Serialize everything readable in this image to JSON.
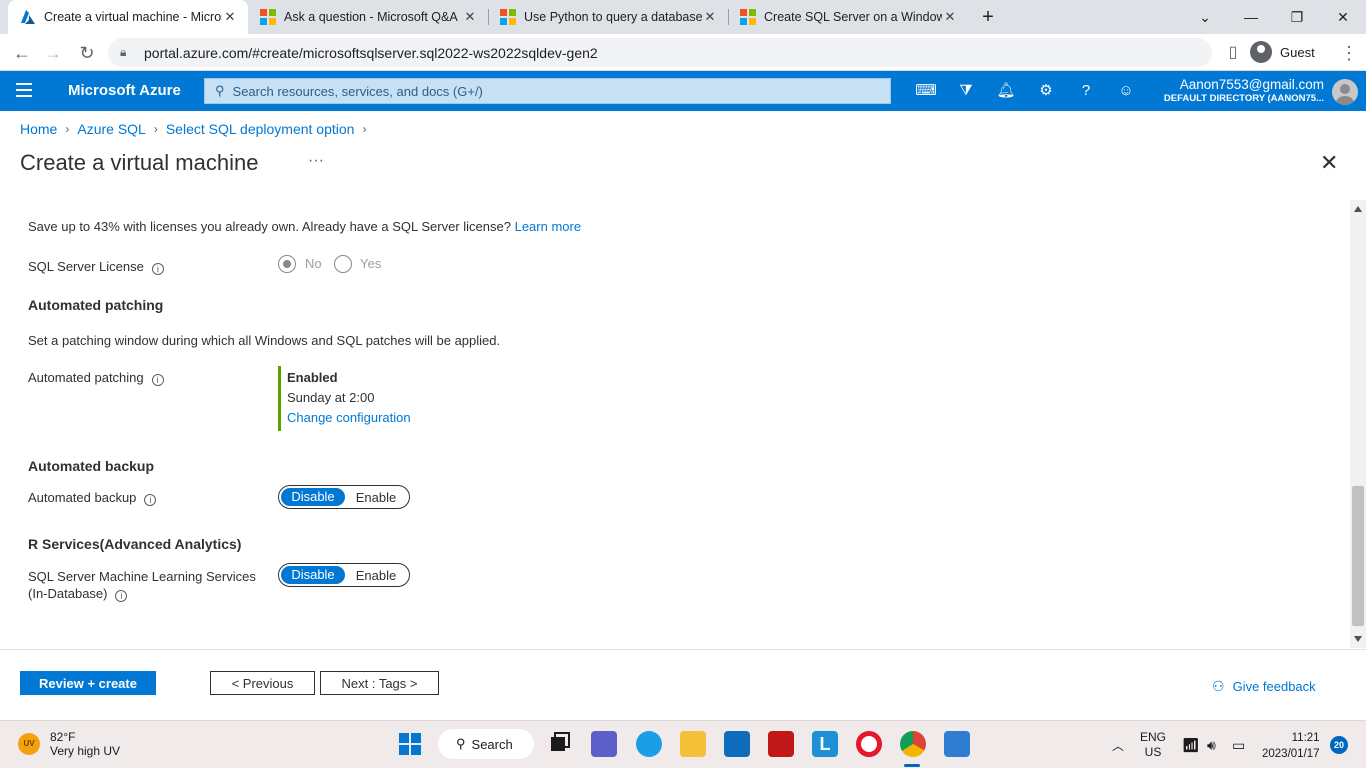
{
  "browser": {
    "tabs": [
      {
        "title": "Create a virtual machine - Micros",
        "icon": "azure-logo-icon",
        "active": true
      },
      {
        "title": "Ask a question - Microsoft Q&A",
        "icon": "microsoft-logo-icon"
      },
      {
        "title": "Use Python to query a database",
        "icon": "microsoft-logo-icon"
      },
      {
        "title": "Create SQL Server on a Windows",
        "icon": "microsoft-logo-icon"
      }
    ],
    "url": "portal.azure.com/#create/microsoftsqlserver.sql2022-ws2022sqldev-gen2",
    "profile": "Guest"
  },
  "azure_header": {
    "brand": "Microsoft Azure",
    "search_placeholder": "Search resources, services, and docs (G+/)",
    "account_email": "Aanon7553@gmail.com",
    "account_directory": "DEFAULT DIRECTORY (AANON75..."
  },
  "breadcrumb": [
    "Home",
    "Azure SQL",
    "Select SQL deployment option"
  ],
  "page": {
    "title": "Create a virtual machine",
    "ellipsis": "···"
  },
  "content": {
    "license_text": "Save up to 43% with licenses you already own. Already have a SQL Server license?",
    "learn_more": "Learn more",
    "sql_license_label": "SQL Server License",
    "radio_no": "No",
    "radio_yes": "Yes",
    "patching_heading": "Automated patching",
    "patching_desc": "Set a patching window during which all Windows and SQL patches will be applied.",
    "patching_label": "Automated patching",
    "patching_status": "Enabled",
    "patching_schedule": "Sunday at 2:00",
    "patching_change": "Change configuration",
    "backup_heading": "Automated backup",
    "backup_label": "Automated backup",
    "backup_toggle": {
      "on": "Disable",
      "off": "Enable"
    },
    "r_heading": "R Services(Advanced Analytics)",
    "ml_label_line1": "SQL Server Machine Learning Services",
    "ml_label_line2": "(In-Database)",
    "ml_toggle": {
      "on": "Disable",
      "off": "Enable"
    }
  },
  "footer": {
    "review_create": "Review + create",
    "previous": "< Previous",
    "next": "Next : Tags >",
    "feedback": "Give feedback"
  },
  "taskbar": {
    "temperature": "82°F",
    "weather": "Very high UV",
    "uv_badge": "UV",
    "search": "Search",
    "lang": "ENG",
    "region": "US",
    "time": "11:21",
    "date": "2023/01/17",
    "notifications": "20"
  }
}
